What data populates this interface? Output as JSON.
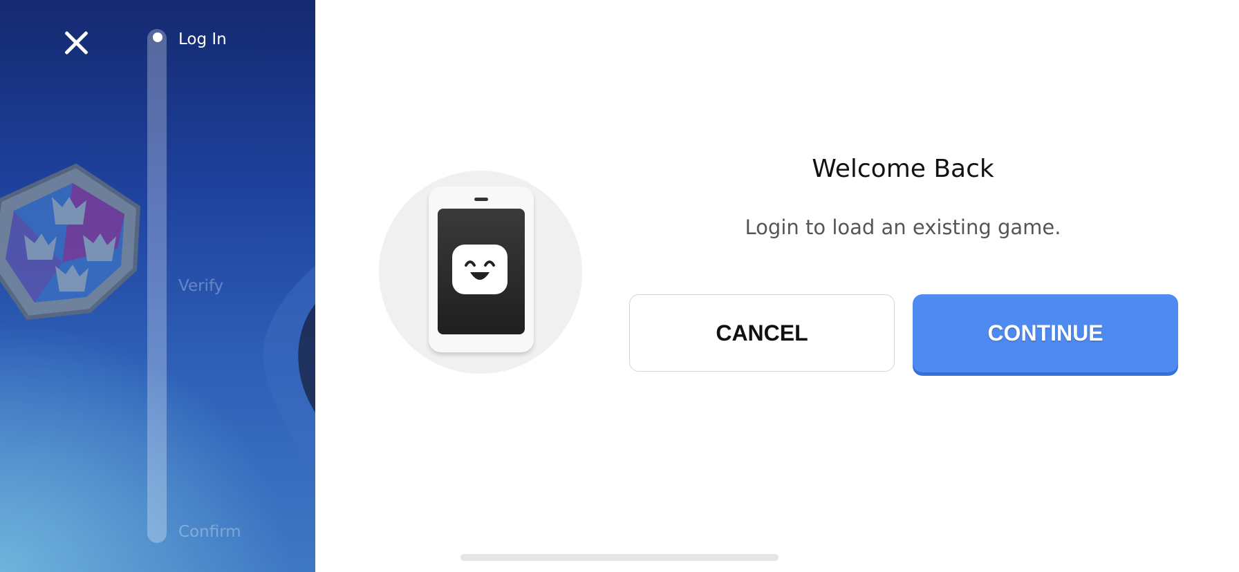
{
  "sidebar": {
    "steps": [
      {
        "label": "Log In"
      },
      {
        "label": "Verify"
      },
      {
        "label": "Confirm"
      }
    ]
  },
  "dialog": {
    "title": "Welcome Back",
    "subtitle": "Login to load an existing game.",
    "cancel_label": "CANCEL",
    "continue_label": "CONTINUE"
  },
  "colors": {
    "accent": "#4f8af0",
    "sidebar_bg": "#1f43a0"
  },
  "icons": {
    "close": "close-icon",
    "illustration": "phone-face-icon"
  }
}
